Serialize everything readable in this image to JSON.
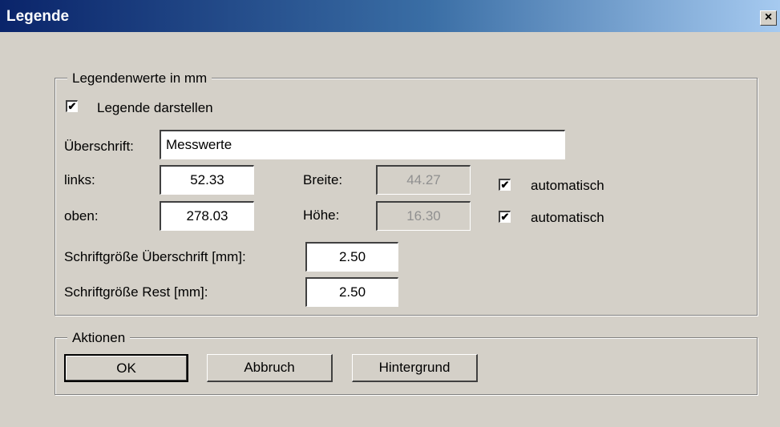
{
  "window": {
    "title": "Legende",
    "close_glyph": "×"
  },
  "legend_group": {
    "label": "Legendenwerte in mm",
    "show_legend": {
      "label": "Legende darstellen",
      "checked": true
    },
    "heading": {
      "label": "Überschrift:",
      "value": "Messwerte"
    },
    "left": {
      "label": "links:",
      "value": "52.33"
    },
    "top": {
      "label": "oben:",
      "value": "278.03"
    },
    "width": {
      "label": "Breite:",
      "value": "44.27"
    },
    "height": {
      "label": "Höhe:",
      "value": "16.30"
    },
    "auto_width": {
      "label": "automatisch",
      "checked": true
    },
    "auto_height": {
      "label": "automatisch",
      "checked": true
    },
    "font_heading": {
      "label": "Schriftgröße Überschrift [mm]:",
      "value": "2.50"
    },
    "font_rest": {
      "label": "Schriftgröße Rest [mm]:",
      "value": "2.50"
    }
  },
  "actions_group": {
    "label": "Aktionen",
    "ok_label": "OK",
    "cancel_label": "Abbruch",
    "background_label": "Hintergrund"
  },
  "check_glyph": "✔"
}
